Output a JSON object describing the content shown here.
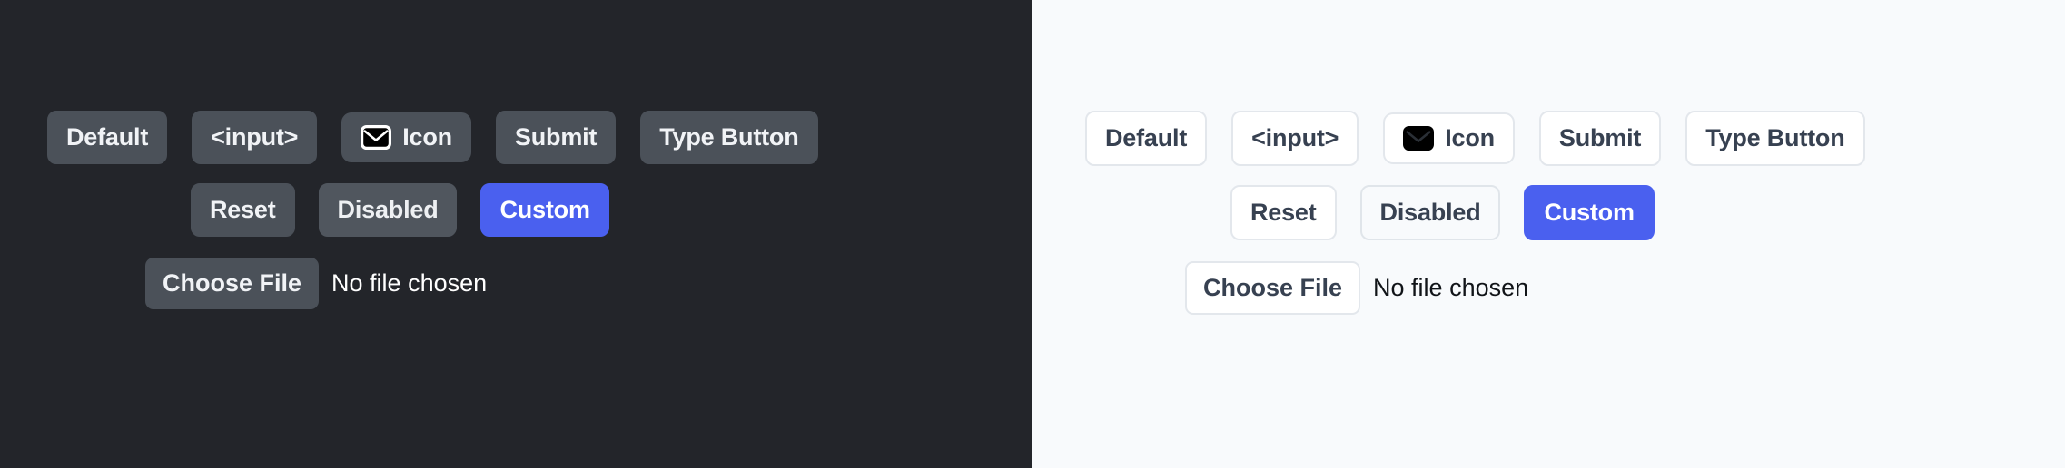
{
  "themes": [
    {
      "name": "dark-theme-panel",
      "background": "#23252a",
      "rows": [
        {
          "name": "primary-buttons-row",
          "buttons": [
            {
              "label": "Default",
              "variant": "default",
              "icon": null
            },
            {
              "label": "<input>",
              "variant": "default",
              "icon": null
            },
            {
              "label": "Icon",
              "variant": "default",
              "icon": "envelope-icon"
            },
            {
              "label": "Submit",
              "variant": "default",
              "icon": null
            },
            {
              "label": "Type Button",
              "variant": "default",
              "icon": null
            }
          ]
        },
        {
          "name": "secondary-buttons-row",
          "buttons": [
            {
              "label": "Reset",
              "variant": "default",
              "icon": null
            },
            {
              "label": "Disabled",
              "variant": "disabled",
              "icon": null
            },
            {
              "label": "Custom",
              "variant": "custom",
              "icon": null
            }
          ]
        }
      ],
      "file_input": {
        "button_label": "Choose File",
        "status_text": "No file chosen"
      }
    },
    {
      "name": "light-theme-panel",
      "background": "#f8fafc",
      "rows": [
        {
          "name": "primary-buttons-row",
          "buttons": [
            {
              "label": "Default",
              "variant": "default",
              "icon": null
            },
            {
              "label": "<input>",
              "variant": "default",
              "icon": null
            },
            {
              "label": "Icon",
              "variant": "default",
              "icon": "envelope-icon"
            },
            {
              "label": "Submit",
              "variant": "default",
              "icon": null
            },
            {
              "label": "Type Button",
              "variant": "default",
              "icon": null
            }
          ]
        },
        {
          "name": "secondary-buttons-row",
          "buttons": [
            {
              "label": "Reset",
              "variant": "default",
              "icon": null
            },
            {
              "label": "Disabled",
              "variant": "disabled",
              "icon": null
            },
            {
              "label": "Custom",
              "variant": "custom",
              "icon": null
            }
          ]
        }
      ],
      "file_input": {
        "button_label": "Choose File",
        "status_text": "No file chosen"
      }
    }
  ],
  "colors": {
    "dark_background": "#23252a",
    "light_background": "#f8fafc",
    "dark_button_fill": "#4b5159",
    "dark_button_text": "#f1f3f6",
    "light_button_fill": "#ffffff",
    "light_button_border": "#e3e7ec",
    "light_button_text": "#374151",
    "custom_accent": "#4a60ef",
    "custom_accent_text": "#ffffff",
    "envelope_icon_fill_dark_panel": "#000000",
    "envelope_icon_stroke_dark_panel": "#ffffff",
    "envelope_icon_fill_light_panel": "#000000",
    "envelope_icon_stroke_light_panel": "#2a2f36"
  }
}
